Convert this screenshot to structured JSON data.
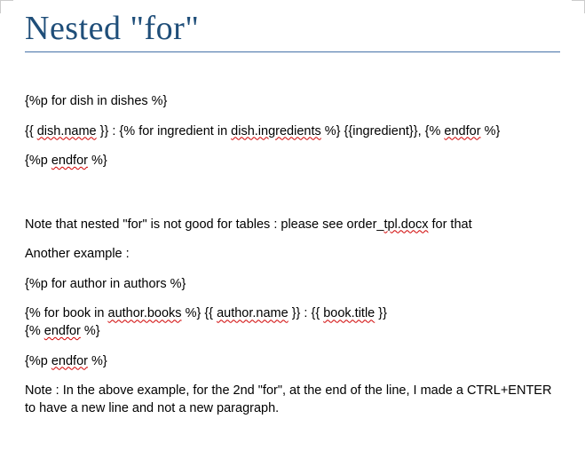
{
  "title": "Nested \"for\"",
  "block1": {
    "line1_a": "{%p for  dish  in dishes %}",
    "line2_a": "{{ ",
    "line2_b_spell": "dish.name",
    "line2_c": " }} : {% for ingredient in ",
    "line2_d_spell": "dish.ingredients",
    "line2_e": " %} {{ingredient}}, {% ",
    "line2_f_spell": "endfor",
    "line2_g": " %}",
    "line3_a": "{%p ",
    "line3_b_spell": "endfor",
    "line3_c": " %}"
  },
  "note1_a": "Note that nested \"for\" is not good for tables : please see order_",
  "note1_b_spell": "tpl.docx",
  "note1_c": " for that",
  "another": "Another example :",
  "block2": {
    "line1_a": "{%p for author in authors %}",
    "line2_a": " {% for book in ",
    "line2_b_spell": "author.books",
    "line2_c": " %} {{ ",
    "line2_d_spell": "author.name",
    "line2_e": " }}  :  {{ ",
    "line2_f_spell": "book.title",
    "line2_g": " }}",
    "line2_h": " {% ",
    "line2_i_spell": "endfor",
    "line2_j": " %}",
    "line3_a": "{%p ",
    "line3_b_spell": "endfor",
    "line3_c": " %}"
  },
  "note2": "Note : In the above example, for the 2nd \"for\", at the end of the line, I made a CTRL+ENTER to have a new line and not a new paragraph."
}
